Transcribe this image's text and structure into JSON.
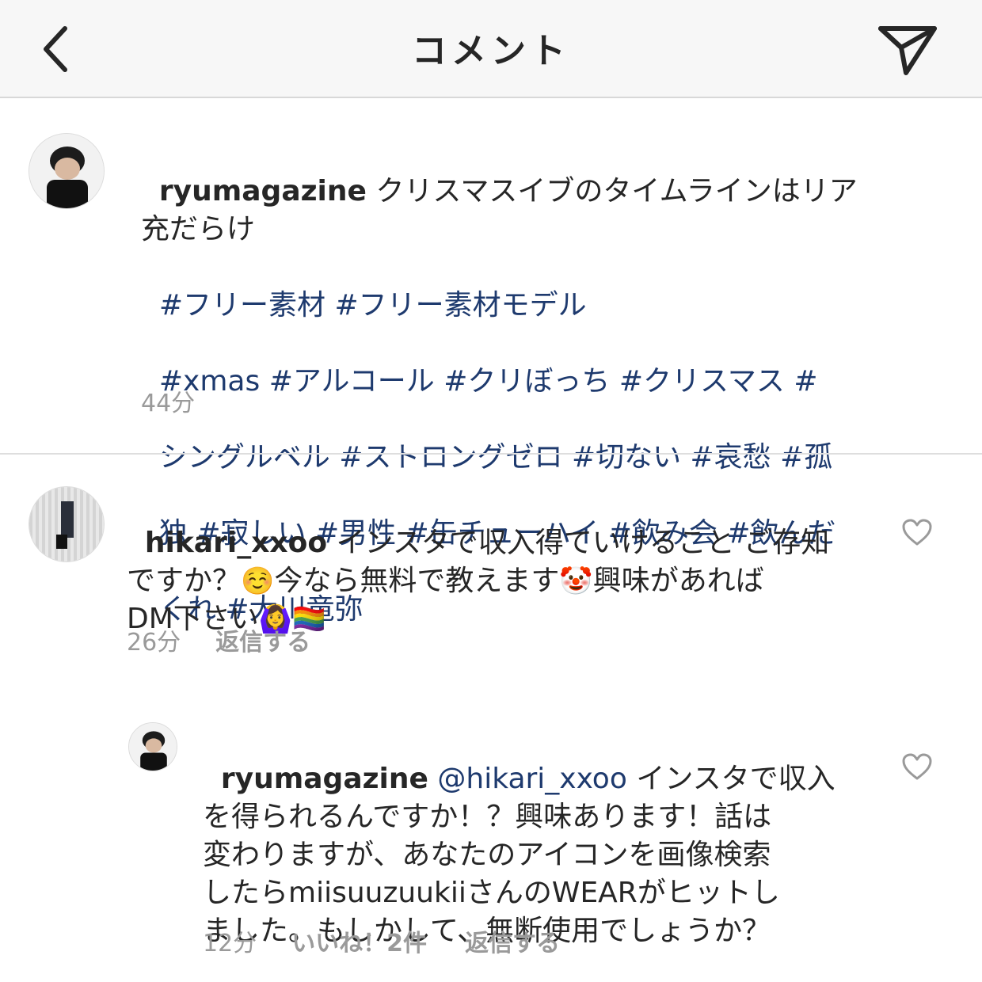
{
  "header": {
    "title": "コメント",
    "back_icon": "chevron-left-icon",
    "share_icon": "paper-plane-icon"
  },
  "caption": {
    "username": "ryumagazine",
    "text": "クリスマスイブのタイムラインはリア充だらけ",
    "hashtags_line1": "#フリー素材 #フリー素材モデル",
    "hashtags_line2": "#xmas #アルコール #クリぼっち #クリスマス #",
    "hashtags_line3": "シングルベル #ストロングゼロ #切ない #哀愁 #孤",
    "hashtags_line4": "独 #寂しい #男性 #缶チューハイ #飲み会 #飲んだ",
    "hashtags_line5": "くれ #大川竜弥",
    "time": "44分"
  },
  "comments": [
    {
      "username": "hikari_xxoo",
      "text_part1": "インスタで収入得ていけること ご存知",
      "text_part2": "ですか？",
      "emoji1": "☺️",
      "text_part3": "今なら無料で教えます",
      "emoji2": "🤡",
      "text_part4": "興味があれば",
      "text_part5": "DM下さい",
      "emoji3": "🙆‍♀️",
      "emoji4": "🏳️‍🌈",
      "time": "26分",
      "reply_label": "返信する"
    },
    {
      "username": "ryumagazine",
      "mention": "@hikari_xxoo",
      "text_line1": "インスタで収入",
      "text_line2": "を得られるんですか！？興味あります！話は",
      "text_line3": "変わりますが、あなたのアイコンを画像検索",
      "text_line4": "したらmiisuuzuukiiさんのWEARがヒットし",
      "text_line5": "ました。もしかして、無断使用でしょうか？",
      "time": "12分",
      "likes_label": "いいね！2件",
      "reply_label": "返信する"
    }
  ],
  "colors": {
    "hashtag": "#1e3a6e",
    "meta": "#9a9a9a",
    "header_bg": "#f7f7f7"
  }
}
